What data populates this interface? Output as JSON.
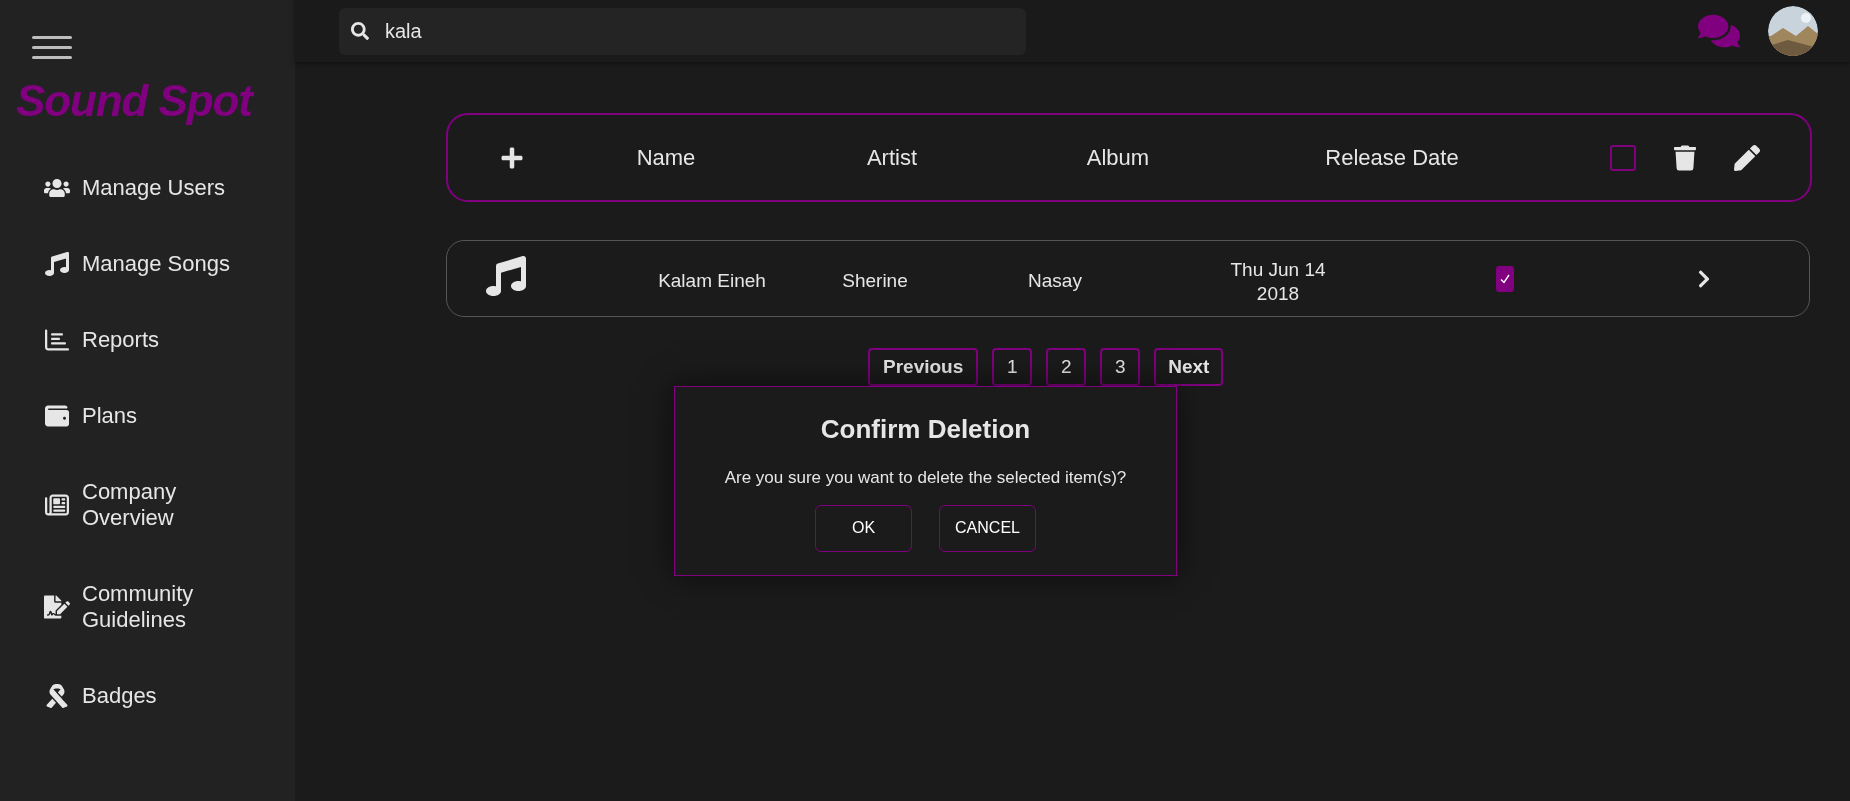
{
  "sidebar": {
    "logo": "Sound Spot",
    "items": [
      {
        "kind": "users",
        "label": "Manage Users"
      },
      {
        "kind": "songs",
        "label": "Manage Songs"
      },
      {
        "kind": "reports",
        "label": "Reports"
      },
      {
        "kind": "plans",
        "label": "Plans"
      },
      {
        "kind": "company",
        "label": "Company Overview"
      },
      {
        "kind": "guidelines",
        "label": "Community Guidelines"
      },
      {
        "kind": "badges",
        "label": "Badges"
      }
    ]
  },
  "search": {
    "value": "kala"
  },
  "table": {
    "columns": [
      "Name",
      "Artist",
      "Album",
      "Release Date"
    ],
    "select_all": {
      "checked": false
    },
    "rows": [
      {
        "name": "Kalam Eineh",
        "artist": "Sherine",
        "album": "Nasay",
        "release_date": "Thu Jun 14 2018",
        "checked": true
      }
    ]
  },
  "pagination": {
    "previous": "Previous",
    "pages": [
      "1",
      "2",
      "3"
    ],
    "next": "Next"
  },
  "dialog": {
    "title": "Confirm Deletion",
    "message": "Are you sure you want to delete the selected item(s)?",
    "buttons": [
      "OK",
      "CANCEL"
    ]
  }
}
